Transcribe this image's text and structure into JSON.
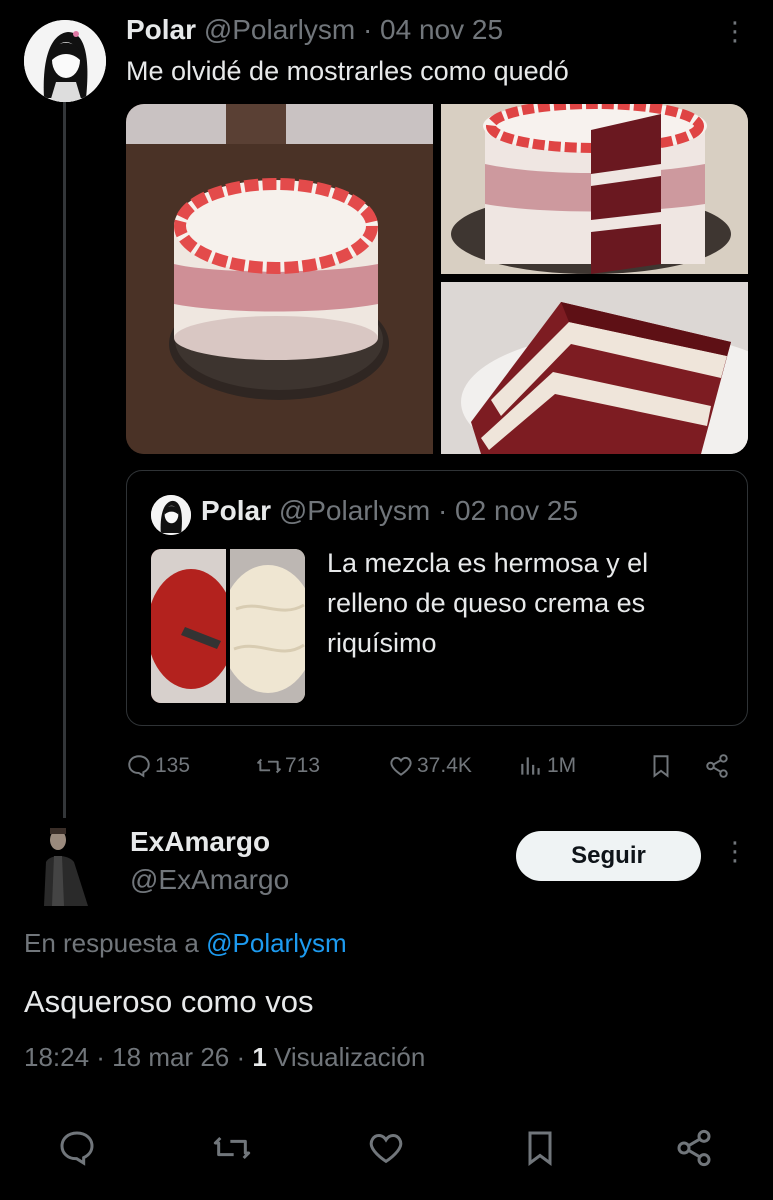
{
  "tweet": {
    "name": "Polar",
    "handle": "@Polarlysm",
    "date": "· 04 nov 25",
    "text": "Me olvidé de mostrarles como quedó",
    "more": "⋮",
    "images": [
      "cake-whole-image",
      "cake-sliced-image",
      "cake-slice-closeup-image"
    ]
  },
  "quote": {
    "name": "Polar",
    "handle": "@Polarlysm",
    "date": "· 02 nov 25",
    "text": "La mezcla es hermosa y el relleno de queso crema es riquísimo"
  },
  "actions": {
    "replies": "135",
    "retweets": "713",
    "likes": "37.4K",
    "views": "1M"
  },
  "reply": {
    "name": "ExAmargo",
    "handle": "@ExAmargo",
    "follow_label": "Seguir",
    "more": "⋮",
    "in_reply_prefix": "En respuesta a",
    "in_reply_handle": "@Polarlysm",
    "text": "Asqueroso como vos",
    "time": "18:24 · 18 mar 26 · ",
    "views_count": "1",
    "views_label": " Visualización"
  },
  "colors": {
    "background": "#000000",
    "muted": "#71767b",
    "link": "#1d9bf0",
    "button_bg": "#eff3f4"
  }
}
